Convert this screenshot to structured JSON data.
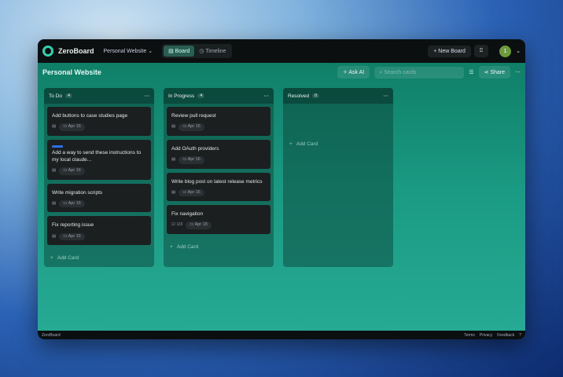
{
  "app": {
    "name": "ZeroBoard",
    "project": "Personal Website",
    "tabs": [
      "Board",
      "Timeline"
    ],
    "new_board": "New Board",
    "avatar": "1"
  },
  "board": {
    "title": "Personal Website",
    "ask_ai": "Ask AI",
    "search_placeholder": "Search cards",
    "share": "Share",
    "add_card": "Add Card",
    "columns": [
      {
        "name": "To Do",
        "count": "4",
        "cards": [
          {
            "title": "Add buttons to case studies page",
            "date": "Apr 16"
          },
          {
            "title": "Add a way to send these instructions to my local claude...",
            "date": "Apr 16",
            "label": true
          },
          {
            "title": "Write migration scripts",
            "date": "Apr 16"
          },
          {
            "title": "Fix reporting issue",
            "date": "Apr 16"
          }
        ]
      },
      {
        "name": "In Progress",
        "count": "4",
        "cards": [
          {
            "title": "Review pull request",
            "date": "Apr 16"
          },
          {
            "title": "Add OAuth providers",
            "date": "Apr 16"
          },
          {
            "title": "Write blog post on latest release metrics",
            "date": "Apr 16"
          },
          {
            "title": "Fix navigation",
            "date": "Apr 18",
            "checklist": "1/3"
          }
        ]
      },
      {
        "name": "Resolved",
        "count": "0",
        "cards": []
      }
    ]
  },
  "footer": {
    "brand": "ZeroBoard",
    "links": [
      "Terms",
      "Privacy",
      "Feedback"
    ]
  }
}
